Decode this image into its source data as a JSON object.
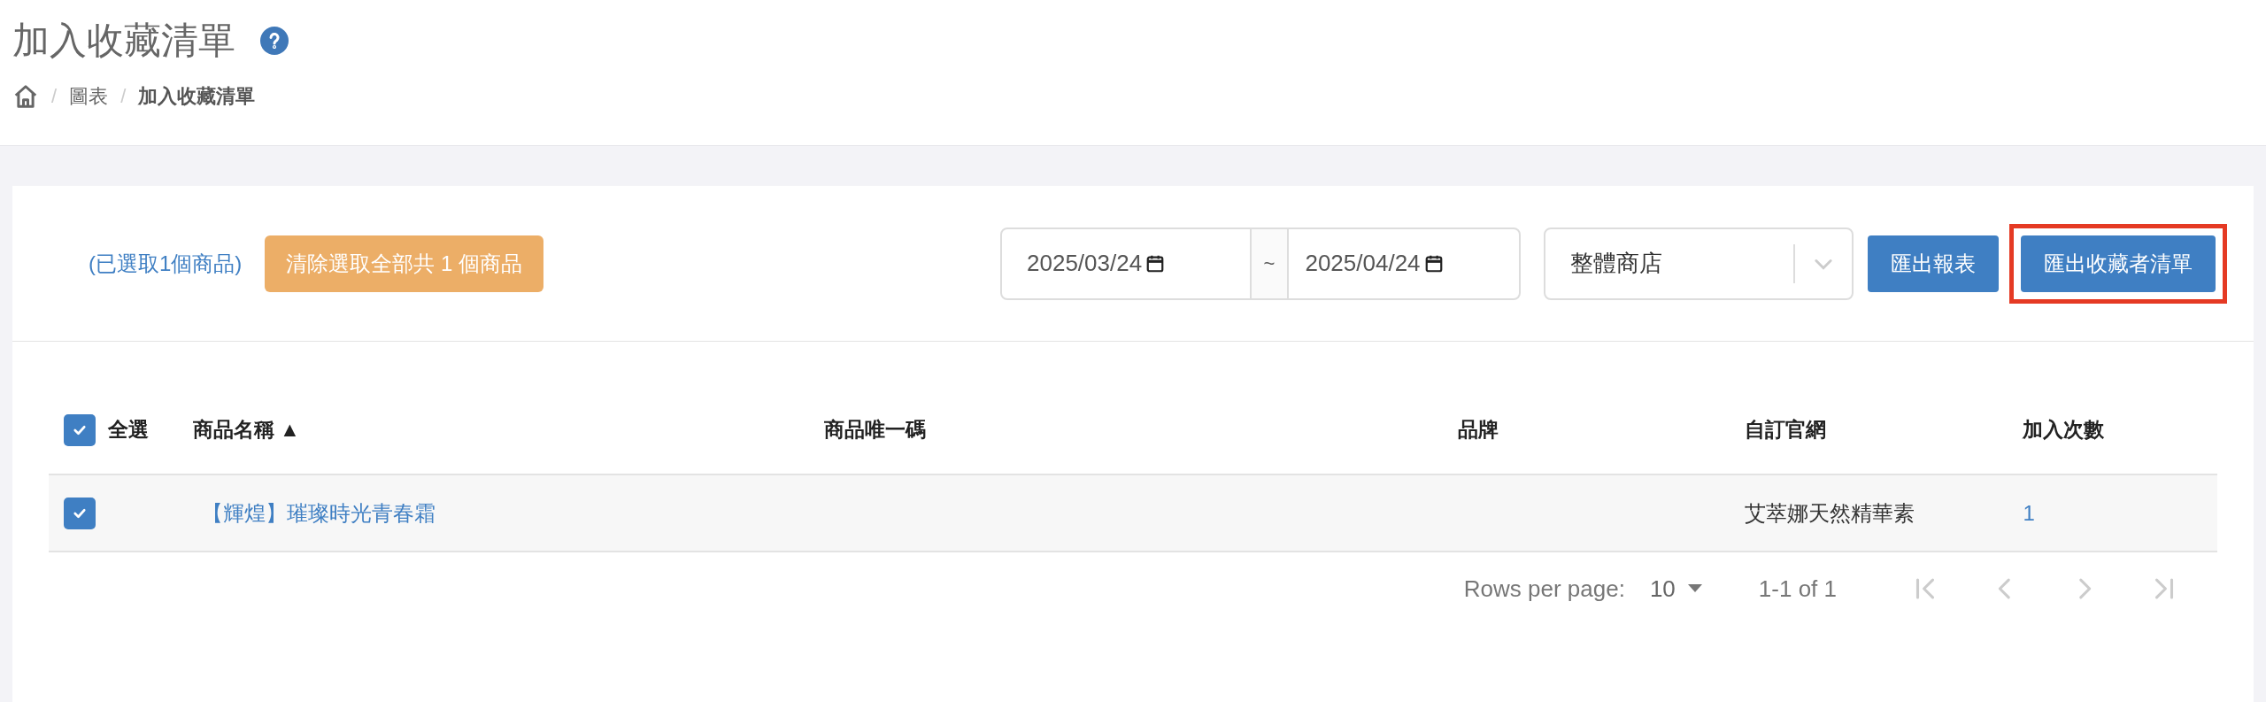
{
  "page_title": "加入收藏清單",
  "breadcrumb": [
    {
      "separator": "/",
      "label": "圖表",
      "current": false
    },
    {
      "separator": "/",
      "label": "加入收藏清單",
      "current": true
    }
  ],
  "toolbar": {
    "selection_note": "(已選取1個商品)",
    "clear_button": "清除選取全部共 1 個商品",
    "date_from": "2025/03/24",
    "range_separator": "~",
    "date_to": "2025/04/24",
    "store_select": "整體商店",
    "buttons": [
      {
        "label": "匯出報表",
        "highlighted": false
      },
      {
        "label": "匯出收藏者清單",
        "highlighted": true
      }
    ]
  },
  "table": {
    "select_all": {
      "label": "全選",
      "checked": true
    },
    "columns": [
      {
        "label": "商品名稱",
        "sort_indicator": "▲"
      },
      {
        "label": "商品唯一碼"
      },
      {
        "label": "品牌"
      },
      {
        "label": "自訂官網"
      },
      {
        "label": "加入次數"
      }
    ],
    "rows": [
      {
        "checked": true,
        "name": "【輝煌】璀璨時光青春霜",
        "site": "艾萃娜天然精華素",
        "count": "1"
      }
    ]
  },
  "pagination": {
    "rows_per_page_label": "Rows per page:",
    "rows_per_page": "10",
    "range": "1-1 of 1",
    "nav": [
      {
        "kind": "first",
        "disabled": true
      },
      {
        "kind": "prev",
        "disabled": true
      },
      {
        "kind": "next",
        "disabled": true
      },
      {
        "kind": "last",
        "disabled": true
      }
    ]
  }
}
